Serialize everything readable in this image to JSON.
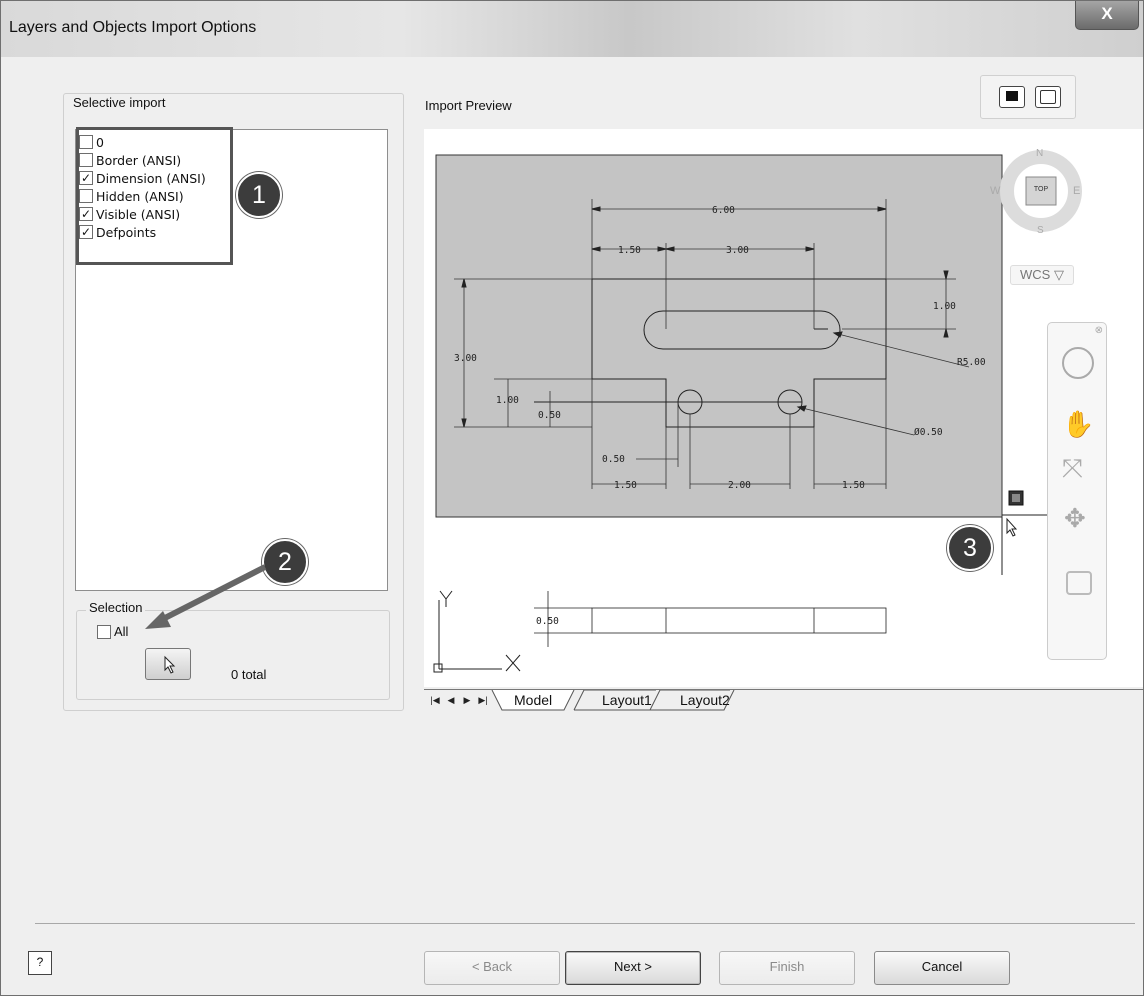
{
  "window": {
    "title": "Layers and Objects Import Options",
    "close_glyph": "X"
  },
  "selective_import": {
    "label": "Selective import",
    "layers": [
      {
        "name": "0",
        "checked": false
      },
      {
        "name": "Border (ANSI)",
        "checked": false
      },
      {
        "name": "Dimension (ANSI)",
        "checked": true
      },
      {
        "name": "Hidden (ANSI)",
        "checked": false
      },
      {
        "name": "Visible (ANSI)",
        "checked": true
      },
      {
        "name": "Defpoints",
        "checked": true
      }
    ]
  },
  "selection": {
    "label": "Selection",
    "all_label": "All",
    "all_checked": false,
    "total": "0 total"
  },
  "preview": {
    "label": "Import Preview",
    "viewcube": {
      "n": "N",
      "s": "S",
      "e": "E",
      "w": "W",
      "top": "TOP",
      "wcs": "WCS ▽"
    },
    "dims": {
      "d600": "6.00",
      "d150a": "1.50",
      "d300a": "3.00",
      "d100a": "1.00",
      "d300b": "3.00",
      "r500": "R5.00",
      "d100b": "1.00",
      "d050a": "0.50",
      "dia050": "Ø0.50",
      "d050b": "0.50",
      "d150b": "1.50",
      "d200": "2.00",
      "d150c": "1.50",
      "d050c": "0.50"
    },
    "ucs": {
      "x": "X",
      "y": "Y"
    }
  },
  "tabs": [
    "Model",
    "Layout1",
    "Layout2"
  ],
  "callouts": [
    "1",
    "2",
    "3"
  ],
  "buttons": {
    "back": "< Back",
    "next": "Next >",
    "finish": "Finish",
    "cancel": "Cancel",
    "help": "?"
  },
  "colors": {
    "drawing_bg": "#c4c4c4",
    "window_bg": "#efefef",
    "callout": "#3c3c3c"
  },
  "icons": {
    "pick": "cursor-arrow-icon",
    "help": "help-icon",
    "close": "close-icon"
  }
}
